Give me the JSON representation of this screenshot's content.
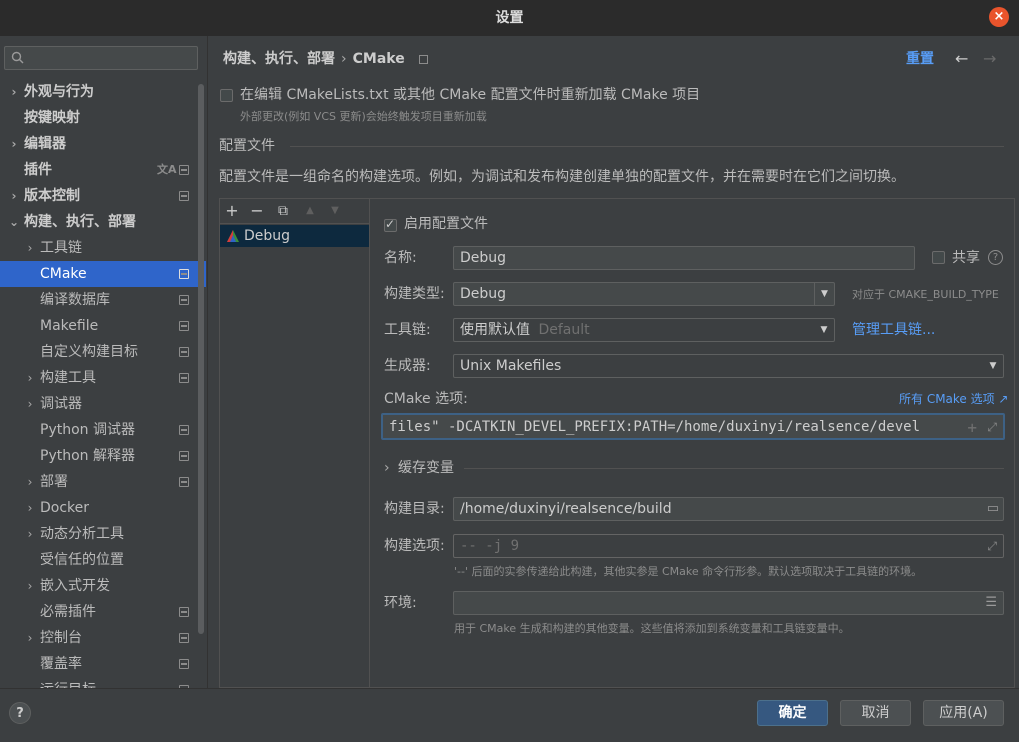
{
  "window": {
    "title": "设置"
  },
  "sidebar": {
    "search_placeholder": "",
    "items": [
      {
        "label": "外观与行为",
        "arrow": "›"
      },
      {
        "label": "按键映射"
      },
      {
        "label": "编辑器",
        "arrow": "›"
      },
      {
        "label": "插件"
      },
      {
        "label": "版本控制",
        "arrow": "›"
      },
      {
        "label": "构建、执行、部署",
        "arrow": "⌄"
      },
      {
        "label": "工具链",
        "arrow": "›"
      },
      {
        "label": "CMake"
      },
      {
        "label": "编译数据库"
      },
      {
        "label": "Makefile"
      },
      {
        "label": "自定义构建目标"
      },
      {
        "label": "构建工具",
        "arrow": "›"
      },
      {
        "label": "调试器",
        "arrow": "›"
      },
      {
        "label": "Python 调试器"
      },
      {
        "label": "Python 解释器"
      },
      {
        "label": "部署",
        "arrow": "›"
      },
      {
        "label": "Docker",
        "arrow": "›"
      },
      {
        "label": "动态分析工具",
        "arrow": "›"
      },
      {
        "label": "受信任的位置"
      },
      {
        "label": "嵌入式开发",
        "arrow": "›"
      },
      {
        "label": "必需插件"
      },
      {
        "label": "控制台",
        "arrow": "›"
      },
      {
        "label": "覆盖率"
      },
      {
        "label": "运行目标"
      }
    ]
  },
  "header": {
    "breadcrumb": [
      "构建、执行、部署",
      "CMake"
    ],
    "reset": "重置",
    "back": "←",
    "forward": "→"
  },
  "reload": {
    "label": "在编辑 CMakeLists.txt 或其他 CMake 配置文件时重新加载 CMake 项目",
    "hint": "外部更改(例如 VCS 更新)会始终触发项目重新加载",
    "checked": false
  },
  "profiles_section": {
    "title": "配置文件",
    "description": "配置文件是一组命名的构建选项。例如，为调试和发布构建创建单独的配置文件，并在需要时在它们之间切换。",
    "toolbar": {
      "add": "+",
      "remove": "−",
      "copy": "⧉",
      "up": "▲",
      "down": "▼"
    },
    "profiles": [
      {
        "name": "Debug"
      }
    ]
  },
  "profile_detail": {
    "enable_label": "启用配置文件",
    "enabled": true,
    "name_label": "名称:",
    "name_value": "Debug",
    "share_label": "共享",
    "build_type_label": "构建类型:",
    "build_type_value": "Debug",
    "build_type_hint": "对应于 CMAKE_BUILD_TYPE",
    "toolchain_label": "工具链:",
    "toolchain_value": "使用默认值",
    "toolchain_default": "Default",
    "manage_toolchains": "管理工具链...",
    "generator_label": "生成器:",
    "generator_value": "Unix Makefiles",
    "cmake_options_label": "CMake 选项:",
    "all_cmake_options": "所有 CMake 选项 ↗",
    "cmake_options_value": "files\" -DCATKIN_DEVEL_PREFIX:PATH=/home/duxinyi/realsence/devel",
    "cache_vars_label": "缓存变量",
    "build_dir_label": "构建目录:",
    "build_dir_value": "/home/duxinyi/realsence/build",
    "build_options_label": "构建选项:",
    "build_options_placeholder": "-- -j 9",
    "build_options_hint": "'--' 后面的实参传递给此构建，其他实参是 CMake 命令行形参。默认选项取决于工具链的环境。",
    "env_label": "环境:",
    "env_value": "",
    "env_hint": "用于 CMake 生成和构建的其他变量。这些值将添加到系统变量和工具链变量中。"
  },
  "footer": {
    "help": "?",
    "ok": "确定",
    "cancel": "取消",
    "apply": "应用(A)"
  },
  "colors": {
    "accent": "#2f65ca",
    "link": "#589df6",
    "background": "#3c3f41"
  }
}
